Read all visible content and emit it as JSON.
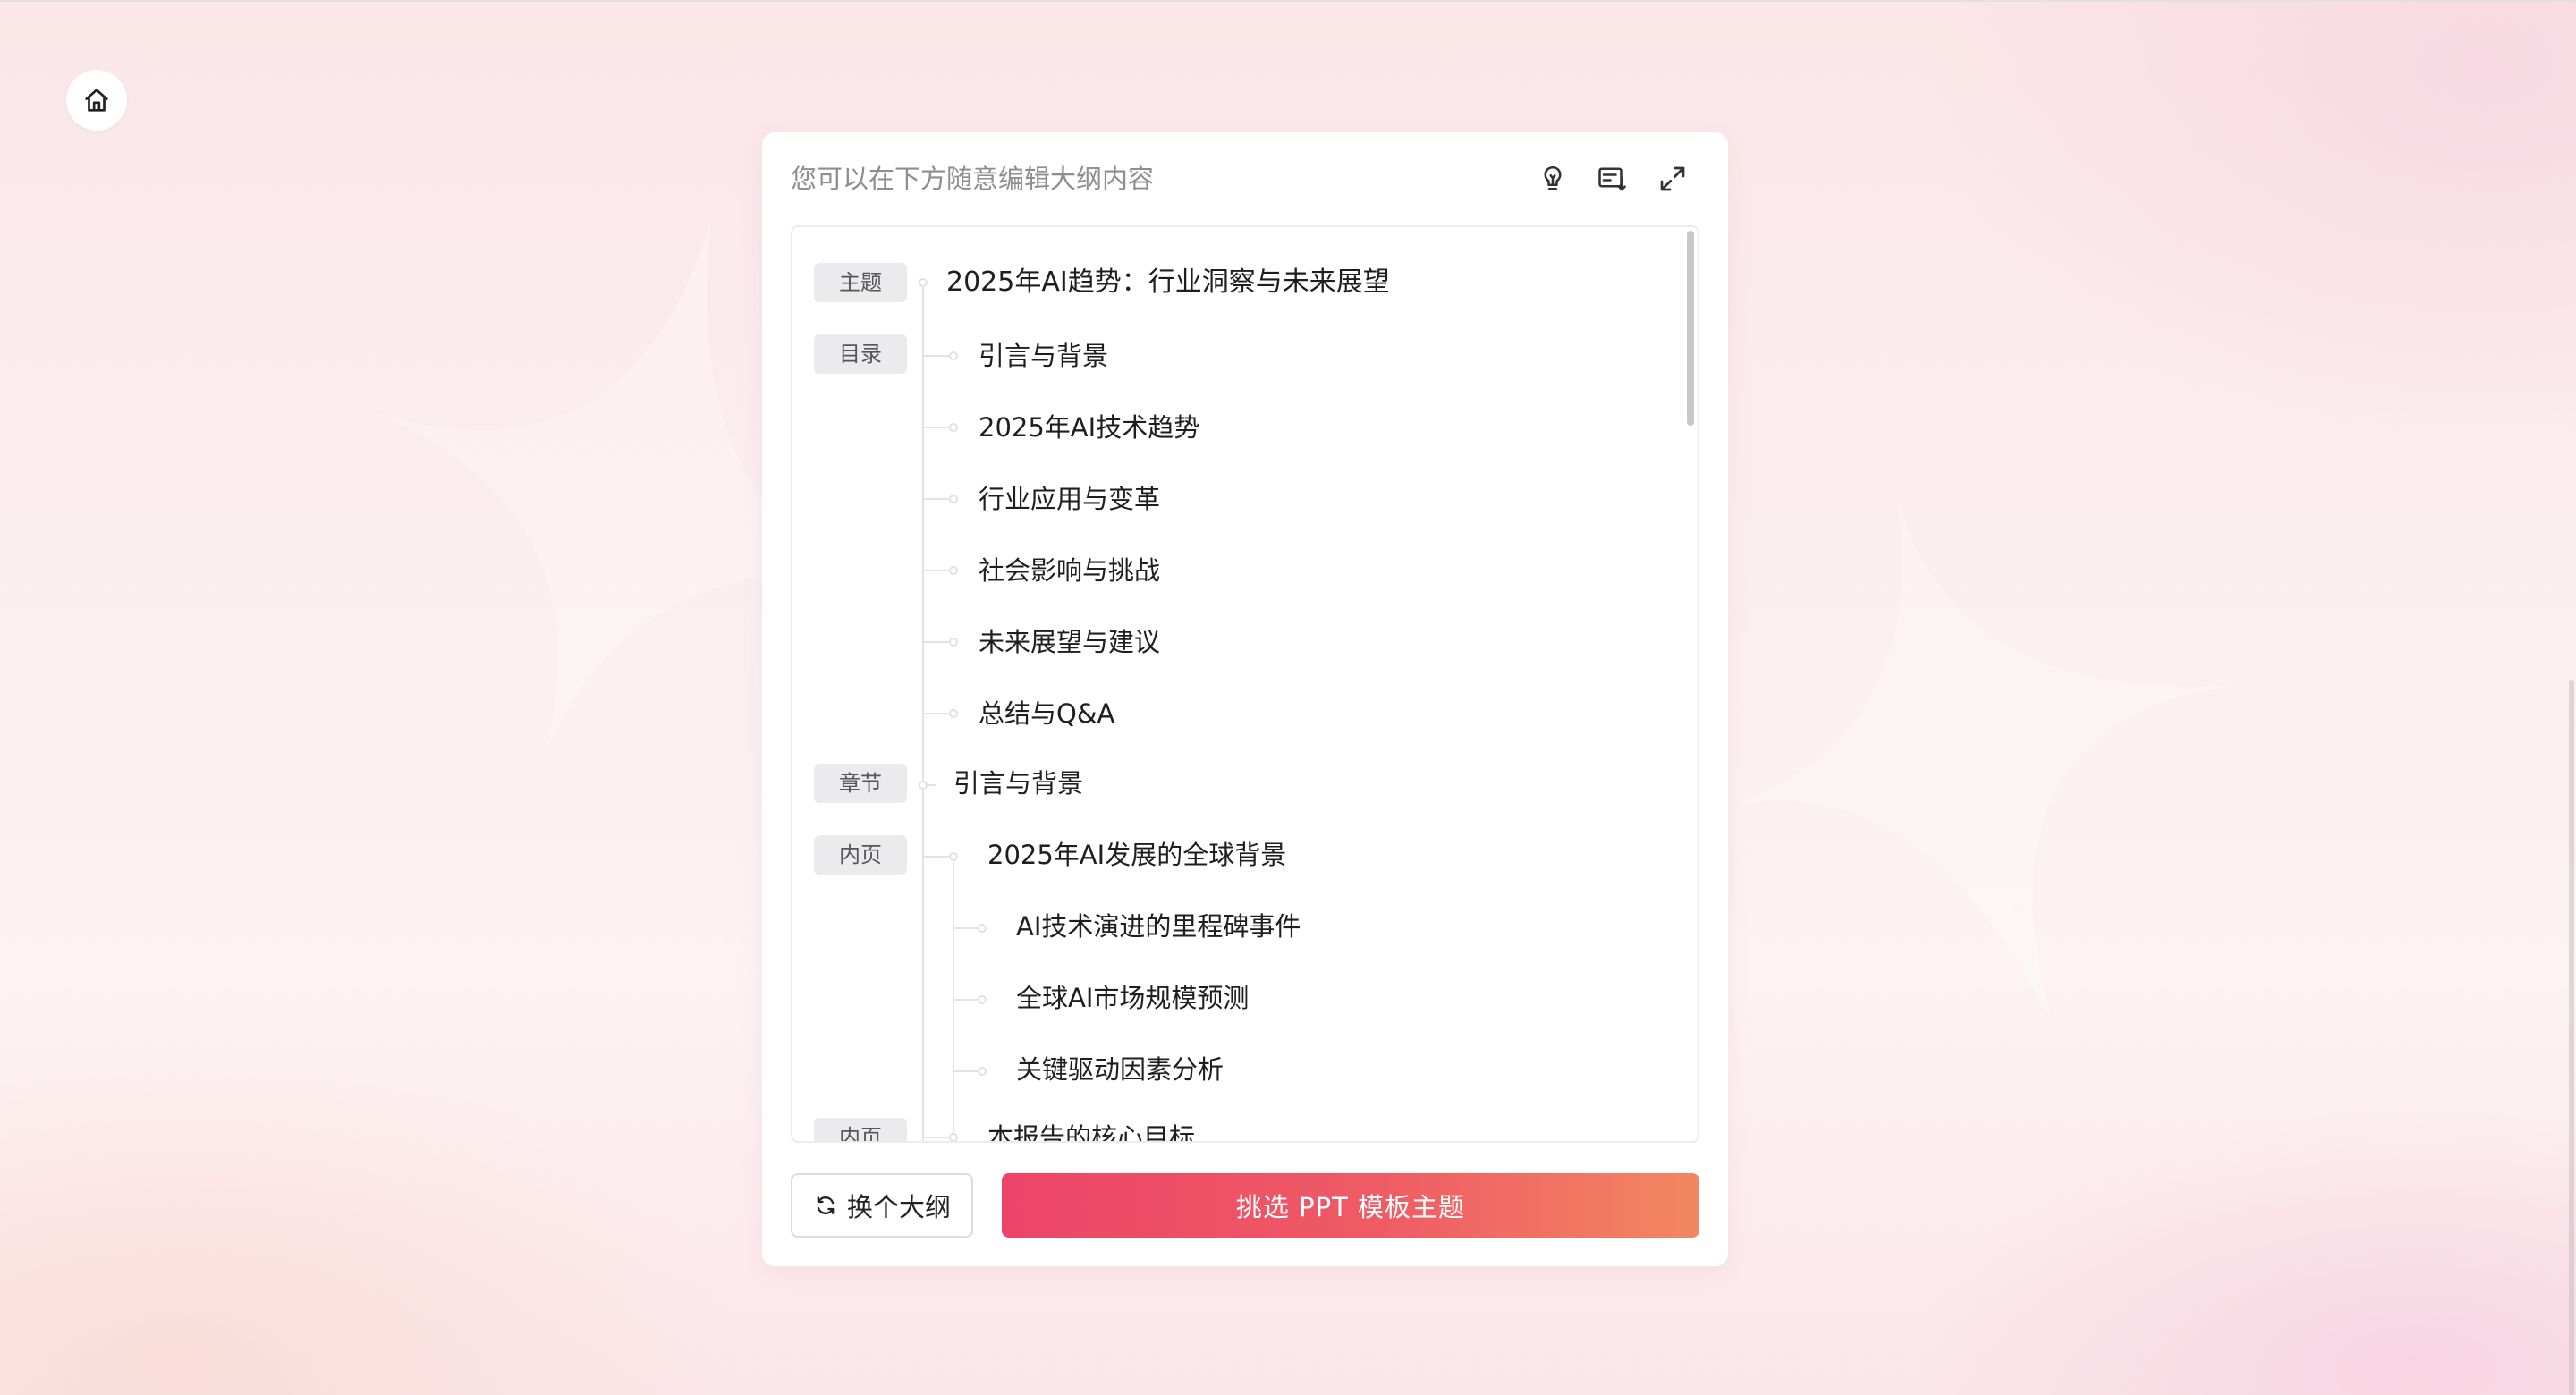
{
  "header": {
    "hint": "您可以在下方随意编辑大纲内容"
  },
  "icons": {
    "home": "home-icon",
    "tips": "lightbulb-icon",
    "outline_view": "outline-list-icon",
    "fullscreen": "expand-icon",
    "refresh": "refresh-icon"
  },
  "outline": {
    "tags": {
      "theme": "主题",
      "toc": "目录",
      "chapter": "章节",
      "page": "内页",
      "page_next": "内页"
    },
    "theme_title": "2025年AI趋势：行业洞察与未来展望",
    "toc_items": [
      "引言与背景",
      "2025年AI技术趋势",
      "行业应用与变革",
      "社会影响与挑战",
      "未来展望与建议",
      "总结与Q&A"
    ],
    "chapter_title": "引言与背景",
    "page_title": "2025年AI发展的全球背景",
    "page_points": [
      "AI技术演进的里程碑事件",
      "全球AI市场规模预测",
      "关键驱动因素分析"
    ],
    "next_page_title": "本报告的核心目标"
  },
  "footer": {
    "switch_label": "换个大纲",
    "pick_label": "挑选 PPT 模板主题"
  },
  "colors": {
    "accent_start": "#ec4468",
    "accent_end": "#f28761",
    "tag_bg": "#ebebed"
  }
}
